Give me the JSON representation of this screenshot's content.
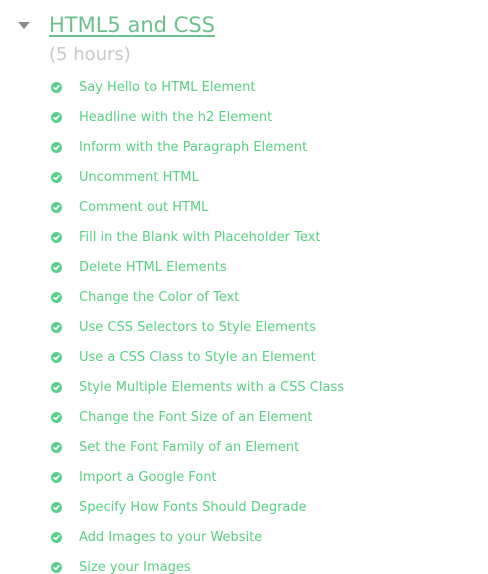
{
  "section": {
    "title": "HTML5 and CSS",
    "duration": "(5 hours)",
    "expanded_icon": "caret-down-icon"
  },
  "colors": {
    "title": "#6fbf8e",
    "lesson_text": "#58d084",
    "check": "#5ccf8d",
    "duration": "#c8c8c8",
    "caret": "#8a8a8a"
  },
  "lessons": [
    {
      "label": "Say Hello to HTML Element",
      "status_icon": "check-circle-icon"
    },
    {
      "label": "Headline with the h2 Element",
      "status_icon": "check-circle-icon"
    },
    {
      "label": "Inform with the Paragraph Element",
      "status_icon": "check-circle-icon"
    },
    {
      "label": "Uncomment HTML",
      "status_icon": "check-circle-icon"
    },
    {
      "label": "Comment out HTML",
      "status_icon": "check-circle-icon"
    },
    {
      "label": "Fill in the Blank with Placeholder Text",
      "status_icon": "check-circle-icon"
    },
    {
      "label": "Delete HTML Elements",
      "status_icon": "check-circle-icon"
    },
    {
      "label": "Change the Color of Text",
      "status_icon": "check-circle-icon"
    },
    {
      "label": "Use CSS Selectors to Style Elements",
      "status_icon": "check-circle-icon"
    },
    {
      "label": "Use a CSS Class to Style an Element",
      "status_icon": "check-circle-icon"
    },
    {
      "label": "Style Multiple Elements with a CSS Class",
      "status_icon": "check-circle-icon"
    },
    {
      "label": "Change the Font Size of an Element",
      "status_icon": "check-circle-icon"
    },
    {
      "label": "Set the Font Family of an Element",
      "status_icon": "check-circle-icon"
    },
    {
      "label": "Import a Google Font",
      "status_icon": "check-circle-icon"
    },
    {
      "label": "Specify How Fonts Should Degrade",
      "status_icon": "check-circle-icon"
    },
    {
      "label": "Add Images to your Website",
      "status_icon": "check-circle-icon"
    },
    {
      "label": "Size your Images",
      "status_icon": "check-circle-icon"
    }
  ]
}
